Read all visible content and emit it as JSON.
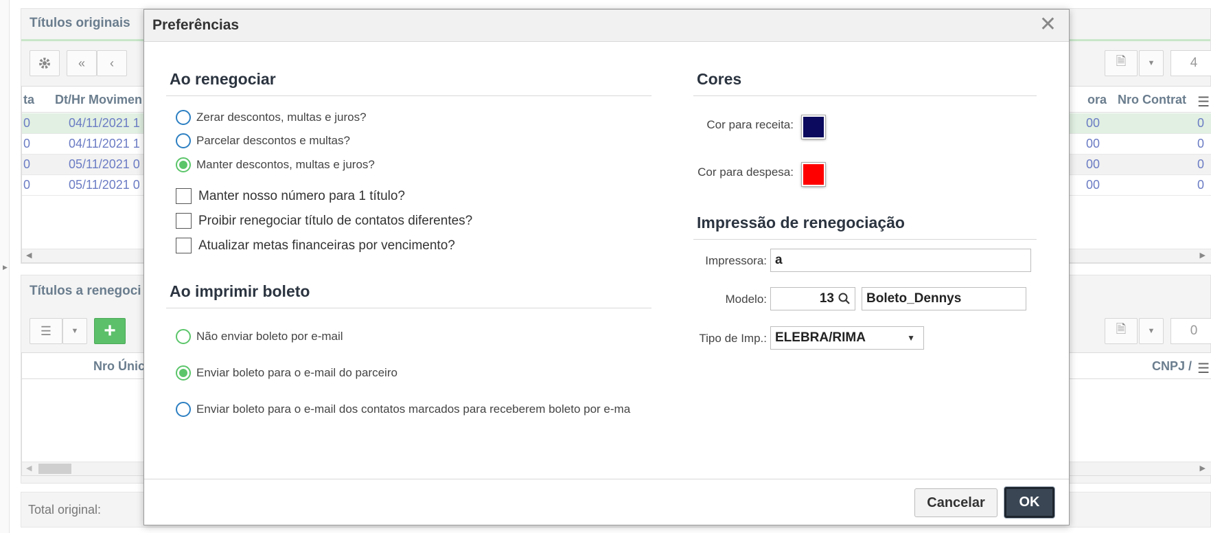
{
  "background": {
    "top_panel_title": "Títulos originais",
    "bottom_panel_title": "Títulos a renegoci",
    "top_count": "4",
    "bottom_count": "0",
    "top_headers": [
      "ta",
      "Dt/Hr Movimen",
      "ora",
      "Nro Contrat"
    ],
    "top_rows": [
      {
        "a": "0",
        "date": "04/11/2021 1",
        "b": "00",
        "c": "0"
      },
      {
        "a": "0",
        "date": "04/11/2021 1",
        "b": "00",
        "c": "0"
      },
      {
        "a": "0",
        "date": "05/11/2021 0",
        "b": "00",
        "c": "0"
      },
      {
        "a": "0",
        "date": "05/11/2021 0",
        "b": "00",
        "c": "0"
      }
    ],
    "bottom_headers": [
      "Nro Únic",
      "CNPJ /"
    ],
    "total_label": "Total original:"
  },
  "modal": {
    "title": "Preferências",
    "close_glyph": "✕",
    "renegociar": {
      "heading": "Ao renegociar",
      "options": [
        "Zerar descontos, multas e juros?",
        "Parcelar descontos e multas?",
        "Manter descontos, multas e juros?"
      ],
      "selected_index": 2,
      "checkboxes": [
        "Manter nosso número para 1 título?",
        "Proibir renegociar título de contatos diferentes?",
        "Atualizar metas financeiras por vencimento?"
      ]
    },
    "boleto": {
      "heading": "Ao imprimir boleto",
      "options": [
        "Não enviar boleto por e-mail",
        "Enviar boleto para o e-mail do parceiro",
        "Enviar boleto para o e-mail dos contatos marcados para receberem boleto por e-ma"
      ],
      "selected_index": 1
    },
    "cores": {
      "heading": "Cores",
      "receita_label": "Cor para receita:",
      "receita_color": "#0b0a5e",
      "despesa_label": "Cor para despesa:",
      "despesa_color": "#ff0000"
    },
    "impressao": {
      "heading": "Impressão de renegociação",
      "impressora_label": "Impressora:",
      "impressora_value": "a",
      "modelo_label": "Modelo:",
      "modelo_code": "13",
      "modelo_name": "Boleto_Dennys",
      "tipo_label": "Tipo de Imp.:",
      "tipo_value": "ELEBRA/RIMA"
    },
    "cancel_label": "Cancelar",
    "ok_label": "OK"
  }
}
